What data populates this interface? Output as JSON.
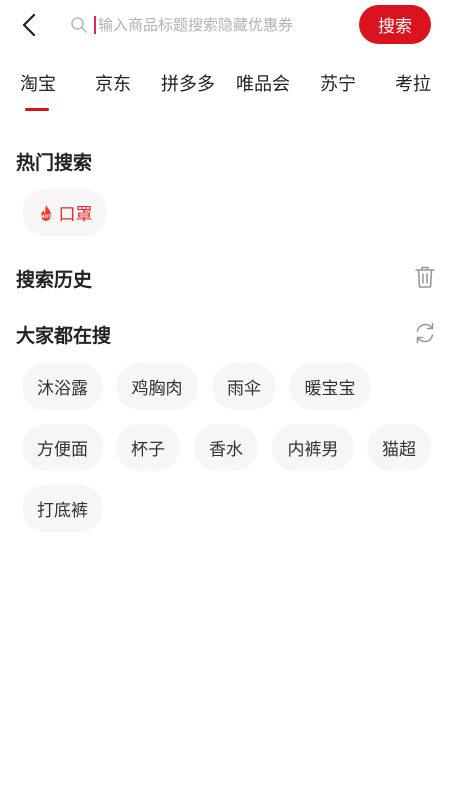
{
  "search": {
    "placeholder": "输入商品标题搜索隐藏优惠券",
    "button_label": "搜索"
  },
  "tabs": [
    {
      "label": "淘宝",
      "selected": true
    },
    {
      "label": "京东"
    },
    {
      "label": "拼多多"
    },
    {
      "label": "唯品会"
    },
    {
      "label": "苏宁"
    },
    {
      "label": "考拉"
    }
  ],
  "hot_search": {
    "title": "热门搜索",
    "items": [
      {
        "label": "口罩",
        "badge": "HOT"
      }
    ]
  },
  "history": {
    "title": "搜索历史"
  },
  "popular": {
    "title": "大家都在搜",
    "items": [
      "沐浴露",
      "鸡胸肉",
      "雨伞",
      "暖宝宝",
      "方便面",
      "杯子",
      "香水",
      "内裤男",
      "猫超",
      "打底裤"
    ]
  },
  "colors": {
    "accent": "#d9141e",
    "chip_bg": "#f6f6f6"
  }
}
